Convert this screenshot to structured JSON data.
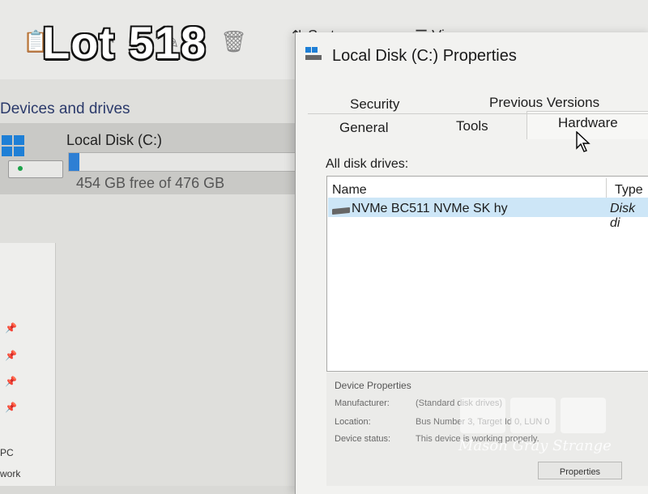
{
  "explorer": {
    "toolbar": {
      "sort_label": "Sort",
      "view_label": "View"
    },
    "section_title": "Devices and drives",
    "drive": {
      "name": "Local Disk (C:)",
      "free_text": "454 GB free of 476 GB",
      "used_fraction": 0.046
    },
    "nav_labels": [
      "PC",
      "work"
    ]
  },
  "dialog": {
    "title": "Local Disk (C:) Properties",
    "tabs": {
      "security": "Security",
      "previous_versions": "Previous Versions",
      "general": "General",
      "tools": "Tools",
      "hardware": "Hardware"
    },
    "all_drives_label": "All disk drives:",
    "columns": {
      "name": "Name",
      "type": "Type"
    },
    "rows": [
      {
        "name": "NVMe BC511 NVMe SK hy",
        "type": "Disk di"
      }
    ],
    "device_properties": {
      "title": "Device Properties",
      "manufacturer_label": "Manufacturer:",
      "manufacturer_value": "(Standard disk drives)",
      "location_label": "Location:",
      "location_value": "Bus Number 3, Target Id 0, LUN 0",
      "status_label": "Device status:",
      "status_value": "This device is working properly.",
      "properties_button": "Properties"
    }
  },
  "overlay": {
    "lot_text": "Lot 518",
    "watermark_logo": "MGS",
    "watermark_text": "Mason Gray Strange"
  },
  "colors": {
    "accent": "#2e7fd4",
    "selection": "#cde6f7",
    "windows_blue": "#1e7fd6"
  }
}
